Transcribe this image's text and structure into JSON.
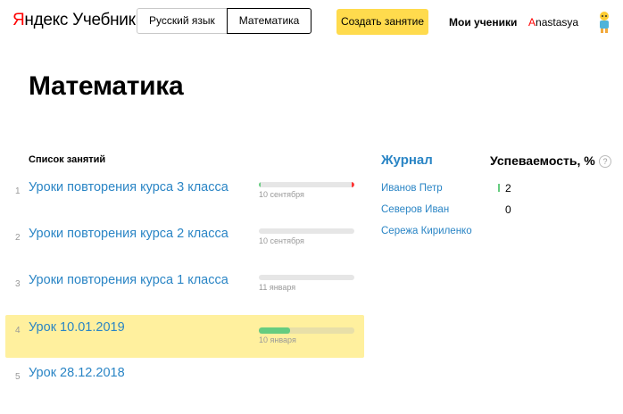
{
  "header": {
    "logo": {
      "brand_first": "Я",
      "brand_rest": "ндекс",
      "product": "Учебник"
    },
    "subjects": [
      {
        "label": "Русский язык",
        "active": false
      },
      {
        "label": "Математика",
        "active": true
      }
    ],
    "create_label": "Создать занятие",
    "students_label": "Мои ученики",
    "user": {
      "first_letter": "A",
      "rest": "nastasya"
    }
  },
  "page_title": "Математика",
  "lessons": {
    "header": "Список занятий",
    "items": [
      {
        "num": "1",
        "title": "Уроки повторения курса 3 класса",
        "date": "10 сентября",
        "progress": 0.02,
        "end_mark": true,
        "highlighted": false
      },
      {
        "num": "2",
        "title": "Уроки повторения курса 2 класса",
        "date": "10 сентября",
        "progress": 0,
        "end_mark": false,
        "highlighted": false
      },
      {
        "num": "3",
        "title": "Уроки повторения курса 1 класса",
        "date": "11 января",
        "progress": 0,
        "end_mark": false,
        "highlighted": false
      },
      {
        "num": "4",
        "title": "Урок 10.01.2019",
        "date": "10 января",
        "progress": 0.33,
        "end_mark": false,
        "highlighted": true
      },
      {
        "num": "5",
        "title": "Урок 28.12.2018",
        "date": "",
        "progress": null,
        "end_mark": false,
        "highlighted": false
      }
    ]
  },
  "journal": {
    "title": "Журнал",
    "performance_title": "Успеваемость, %",
    "help_symbol": "?",
    "students": [
      {
        "name": "Иванов Петр",
        "score": "2",
        "bar": true
      },
      {
        "name": "Северов Иван",
        "score": "0",
        "bar": false
      },
      {
        "name": "Сережа Кириленко",
        "score": "",
        "bar": false
      }
    ]
  },
  "colors": {
    "accent_yellow": "#ffdb4d",
    "highlight_row": "#fff09e",
    "link_blue": "#2a85c5",
    "progress_green": "#66cc80",
    "progress_red": "#ff3333",
    "brand_red": "#ff0000"
  }
}
